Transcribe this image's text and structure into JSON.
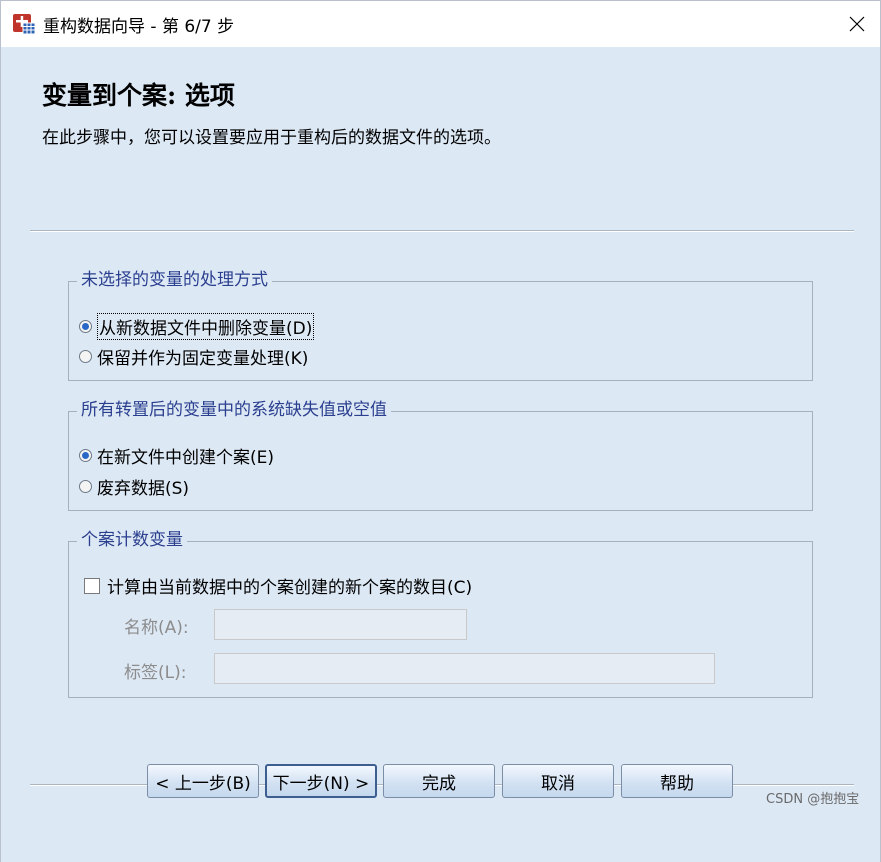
{
  "window": {
    "title": "重构数据向导 - 第 6/7 步"
  },
  "header": {
    "heading": "变量到个案: 选项",
    "description": "在此步骤中，您可以设置要应用于重构后的数据文件的选项。"
  },
  "group_unselected": {
    "label": "未选择的变量的处理方式",
    "options": [
      {
        "label": "从新数据文件中删除变量(D)",
        "checked": true
      },
      {
        "label": "保留并作为固定变量处理(K)",
        "checked": false
      }
    ]
  },
  "group_missing": {
    "label": "所有转置后的变量中的系统缺失值或空值",
    "options": [
      {
        "label": "在新文件中创建个案(E)",
        "checked": true
      },
      {
        "label": "废弃数据(S)",
        "checked": false
      }
    ]
  },
  "group_count": {
    "label": "个案计数变量",
    "checkbox_label": "计算由当前数据中的个案创建的新个案的数目(C)",
    "checked": false,
    "name_label": "名称(A):",
    "name_value": "",
    "label_label": "标签(L):",
    "label_value": ""
  },
  "buttons": {
    "back": "< 上一步(B)",
    "next": "下一步(N) >",
    "finish": "完成",
    "cancel": "取消",
    "help": "帮助"
  },
  "watermark": "CSDN @抱抱宝"
}
